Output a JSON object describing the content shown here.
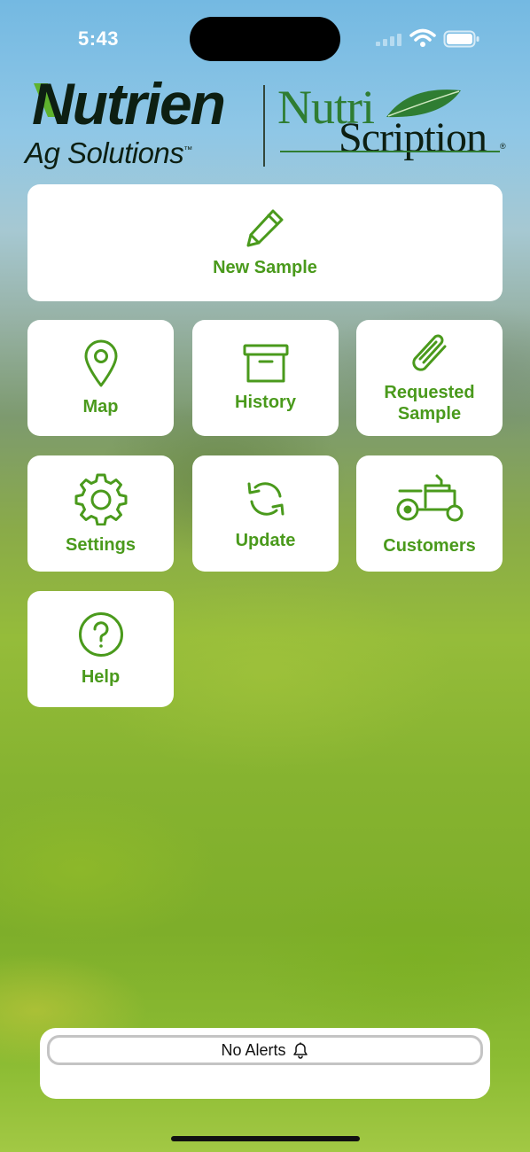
{
  "status_bar": {
    "time": "5:43",
    "icons": [
      "cellular-signal-icon",
      "wifi-icon",
      "battery-icon"
    ]
  },
  "branding": {
    "primary_logo": {
      "name": "Nutrien",
      "tagline": "Ag Solutions",
      "trademark": "™"
    },
    "secondary_logo": {
      "part1": "Nutri",
      "part2": "Scription",
      "registered": "®"
    }
  },
  "menu": {
    "new_sample": {
      "label": "New Sample",
      "icon": "pencil-icon"
    },
    "map": {
      "label": "Map",
      "icon": "map-pin-icon"
    },
    "history": {
      "label": "History",
      "icon": "archive-box-icon"
    },
    "requested_sample": {
      "line1": "Requested",
      "line2": "Sample",
      "icon": "paperclip-icon"
    },
    "settings": {
      "label": "Settings",
      "icon": "gear-icon"
    },
    "update": {
      "label": "Update",
      "icon": "refresh-icon"
    },
    "customers": {
      "label": "Customers",
      "icon": "tractor-icon"
    },
    "help": {
      "label": "Help",
      "icon": "question-circle-icon"
    }
  },
  "alerts": {
    "label": "No Alerts",
    "icon": "bell-icon"
  },
  "colors": {
    "accent": "#4a9a1c",
    "brand_green": "#2f7d32",
    "logo_dark": "#0d1f12"
  }
}
